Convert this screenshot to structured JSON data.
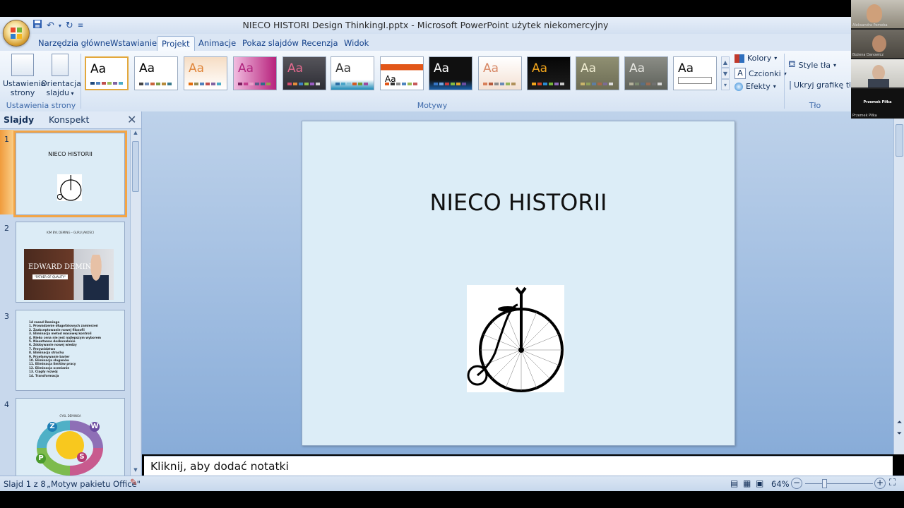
{
  "window": {
    "title": "NIECO HISTORI Design ThinkingI.pptx - Microsoft PowerPoint użytek niekomercyjny"
  },
  "tabs": [
    "Narzędzia główne",
    "Wstawianie",
    "Projekt",
    "Animacje",
    "Pokaz slajdów",
    "Recenzja",
    "Widok"
  ],
  "active_tab": "Projekt",
  "ribbon": {
    "page_setup": {
      "btn1": "Ustawienia strony",
      "btn2": "Orientacja slajdu",
      "label": "Ustawienia strony"
    },
    "themes": {
      "label": "Motywy",
      "preview_text": "Aa",
      "colors": "Kolory",
      "fonts": "Czcionki",
      "effects": "Efekty"
    },
    "background": {
      "styles": "Style tła",
      "hide": "Ukryj grafikę tła",
      "label": "Tło"
    }
  },
  "leftpane": {
    "tab_slides": "Slajdy",
    "tab_outline": "Konspekt",
    "thumbs": [
      {
        "num": "1",
        "title": "NIECO HISTORII"
      },
      {
        "num": "2",
        "title": "KIM  BYŁ DEMING – GURU JAKOŚCI",
        "banner": "EDWARD DEMING",
        "sub": "\"FATHER OF QUALITY\""
      },
      {
        "num": "3",
        "title": "14 zasad Deminga",
        "items": [
          "1. Prowadzenie długofalowych zamierzeń",
          "2. Zaakceptowanie nowej filozofii",
          "3. Eliminacja metod masowej kontroli",
          "4. Nieko cena nie jest najlepszym wyborem",
          "5. Nieustanne doskonalenie",
          "6. Zdobywanie nowej wiedzy",
          "7. Przywództwo",
          "8. Eliminacja strachu",
          "9. Przełamywanie barier",
          "10. Eliminacja sloganów",
          "11. Eliminacja limitów pracy",
          "12. Eliminacja ocenianie",
          "13. Ciągły rozwój",
          "14. Transformacja"
        ]
      },
      {
        "num": "4",
        "title": "CYKL DEMINGA",
        "letters": [
          "Z",
          "W",
          "P",
          "S"
        ]
      }
    ]
  },
  "slide": {
    "title": "NIECO HISTORII"
  },
  "notes": {
    "placeholder": "Kliknij, aby dodać notatki"
  },
  "status": {
    "slide": "Slajd 1 z 8",
    "theme": "„Motyw pakietu Office\"",
    "zoom": "64%"
  },
  "video": {
    "participants": [
      "Aleksandra Pomeba",
      "Bożena Danowicz",
      "Przemek Piłka"
    ],
    "active_label": "Przemek Piłka"
  }
}
